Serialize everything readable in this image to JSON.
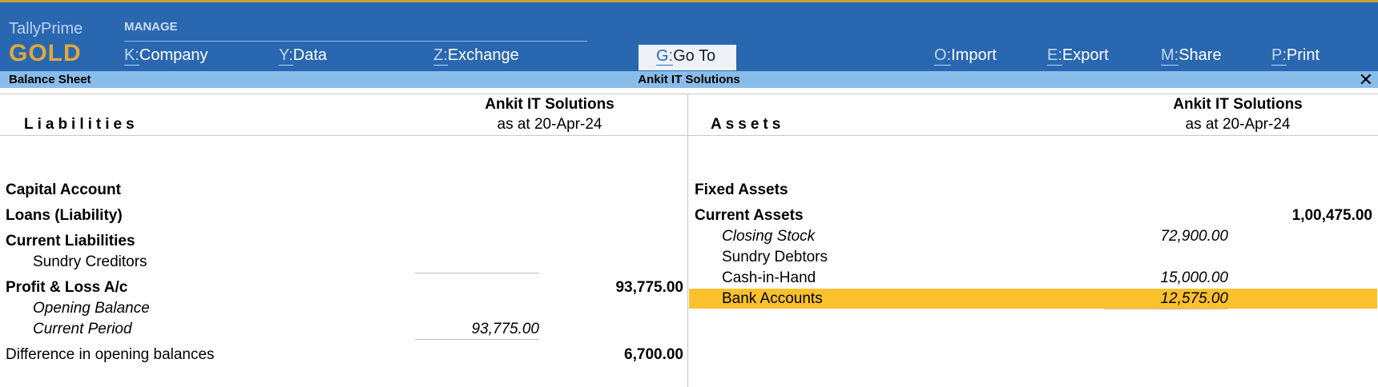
{
  "brand": {
    "name": "TallyPrime",
    "tier": "GOLD"
  },
  "menu": {
    "manage_label": "MANAGE",
    "company": {
      "key": "K:",
      "label": "Company"
    },
    "data": {
      "key": "Y:",
      "label": "Data"
    },
    "exchange": {
      "key": "Z:",
      "label": "Exchange"
    },
    "goto": {
      "key": "G:",
      "label": "Go To"
    },
    "import": {
      "key": "O:",
      "label": "Import"
    },
    "export": {
      "key": "E:",
      "label": "Export"
    },
    "share": {
      "key": "M:",
      "label": "Share"
    },
    "print": {
      "key": "P:",
      "label": "Print"
    }
  },
  "strip": {
    "report": "Balance Sheet",
    "company": "Ankit IT Solutions",
    "close": "✕"
  },
  "liabilities": {
    "title": "Liabilities",
    "company": "Ankit IT Solutions",
    "date": "as at 20-Apr-24",
    "rows": {
      "capital": "Capital Account",
      "loans": "Loans (Liability)",
      "current": "Current Liabilities",
      "sundry_creditors": "Sundry Creditors",
      "pl": "Profit & Loss A/c",
      "pl_total": "93,775.00",
      "opening": "Opening Balance",
      "current_period": "Current Period",
      "current_period_value": "93,775.00",
      "difference": "Difference in opening balances",
      "difference_value": "6,700.00"
    }
  },
  "assets": {
    "title": "Assets",
    "company": "Ankit IT Solutions",
    "date": "as at 20-Apr-24",
    "rows": {
      "fixed": "Fixed Assets",
      "current": "Current Assets",
      "current_total": "1,00,475.00",
      "closing_stock": "Closing Stock",
      "closing_stock_value": "72,900.00",
      "sundry_debtors": "Sundry Debtors",
      "cash": "Cash-in-Hand",
      "cash_value": "15,000.00",
      "bank": "Bank Accounts",
      "bank_value": "12,575.00"
    }
  }
}
